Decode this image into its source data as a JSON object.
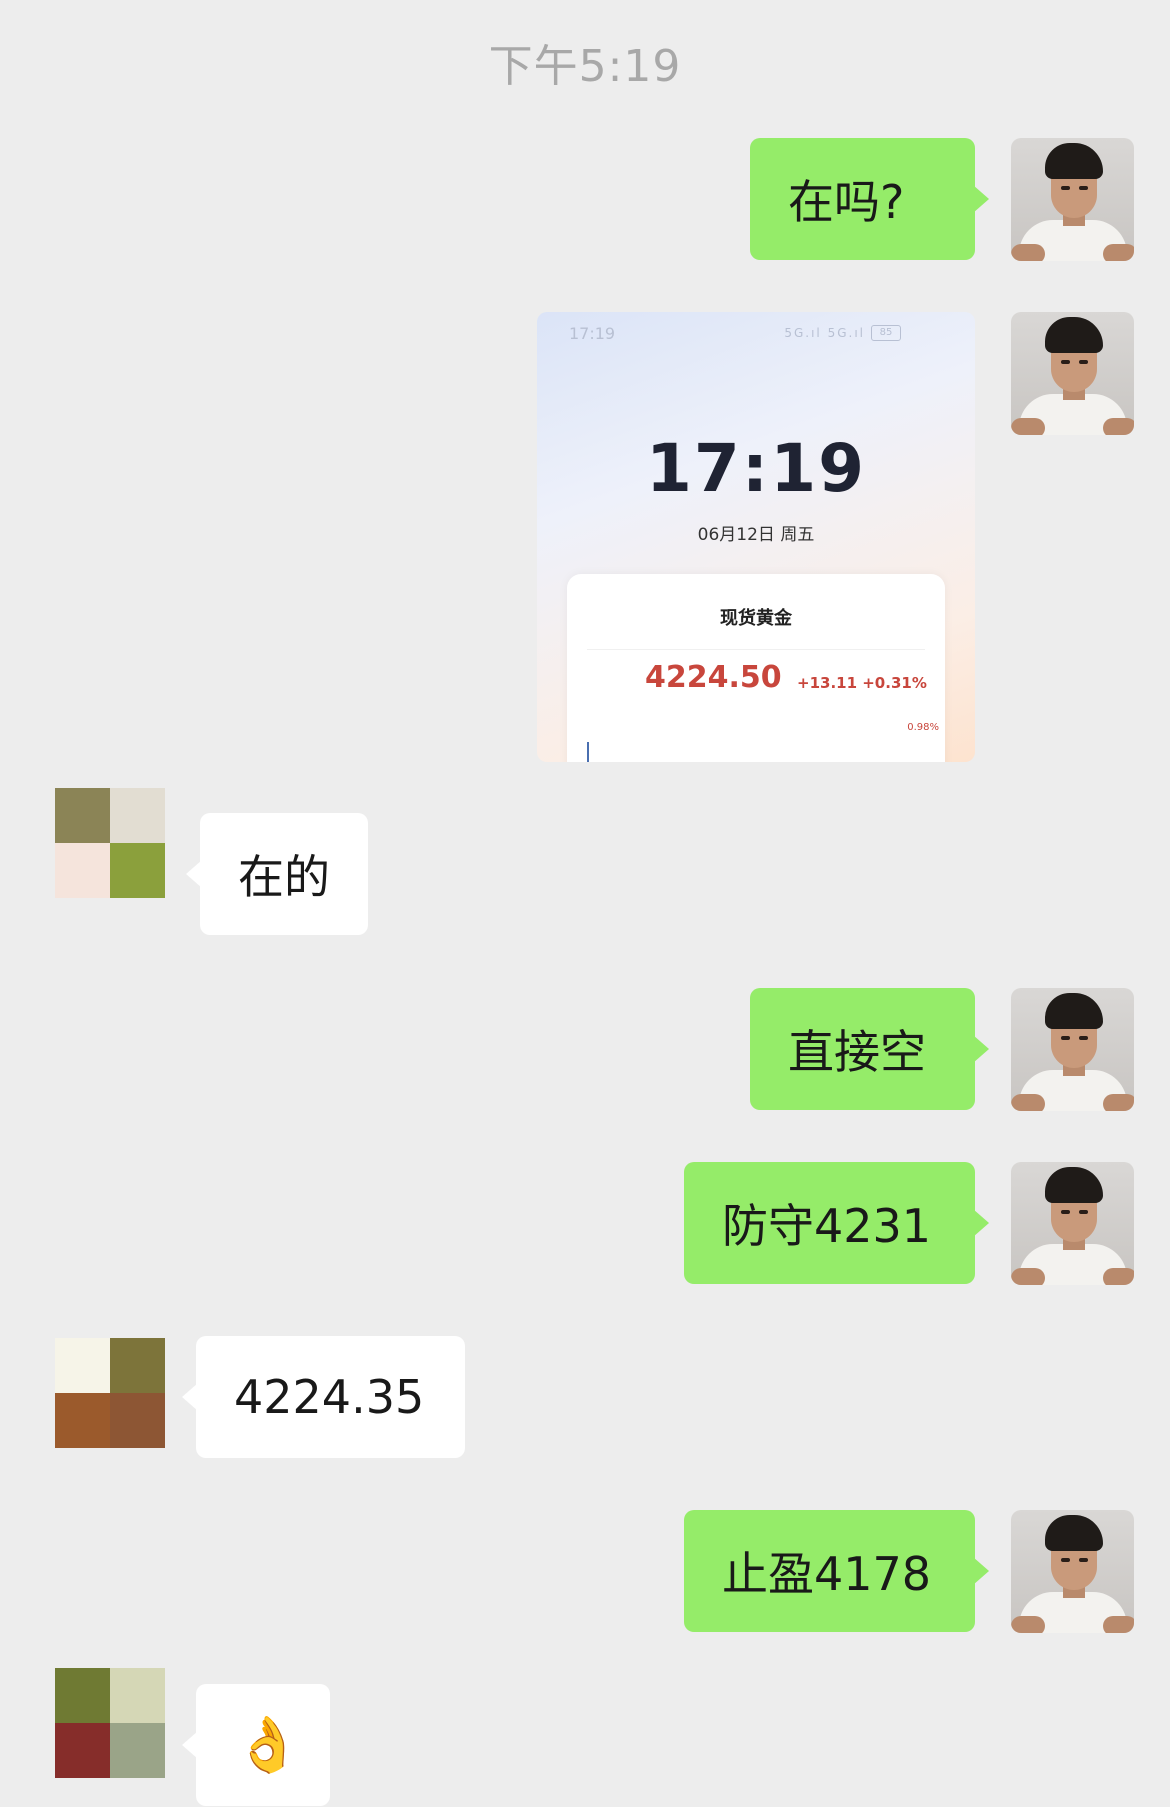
{
  "chat": {
    "timestamp": "下午5:19",
    "messages": [
      {
        "from": "me",
        "type": "text",
        "text": "在吗?"
      },
      {
        "from": "me",
        "type": "image"
      },
      {
        "from": "other",
        "type": "text",
        "text": "在的"
      },
      {
        "from": "me",
        "type": "text",
        "text": "直接空"
      },
      {
        "from": "me",
        "type": "text",
        "text": "防守4231"
      },
      {
        "from": "other",
        "type": "text",
        "text": "4224.35"
      },
      {
        "from": "me",
        "type": "text",
        "text": "止盈4178"
      },
      {
        "from": "other",
        "type": "emoji",
        "text": "👌"
      }
    ]
  },
  "shared_screenshot": {
    "status_time": "17:19",
    "status_icons": "5G.ıl 5G.ıl",
    "battery": "85",
    "clock": "17:19",
    "date": "06月12日 周五",
    "card_title": "现货黄金",
    "price": "4224.50",
    "change": "+13.11 +0.31%",
    "percent_label": "0.98%"
  },
  "avatars": {
    "other_colors_1": [
      "#8b8456",
      "#e2ddd2",
      "#f5e4dc",
      "#8ba03c"
    ],
    "other_colors_2": [
      "#f6f4e8",
      "#7d743a",
      "#9b5a2c",
      "#8d5634"
    ],
    "other_colors_3": [
      "#6f7a33",
      "#d5d7b6",
      "#862d2a",
      "#9aa488"
    ]
  },
  "colors": {
    "background": "#ededed",
    "sent_bubble": "#95ec69",
    "received_bubble": "#ffffff",
    "price_red": "#c8463c"
  }
}
